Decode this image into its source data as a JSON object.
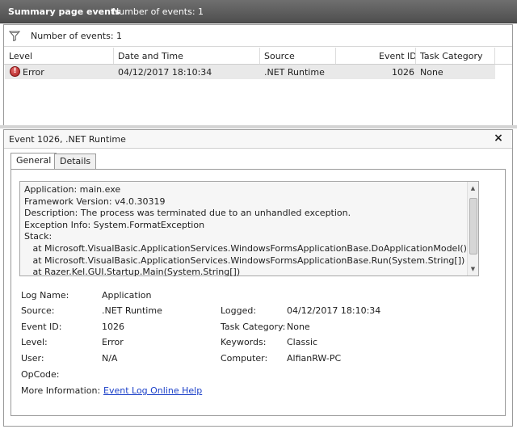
{
  "titlebar": {
    "title": "Summary page events",
    "count": "Number of events: 1"
  },
  "filter": {
    "icon": "filter-icon",
    "text": "Number of events: 1"
  },
  "columns": {
    "level": "Level",
    "datetime": "Date and Time",
    "source": "Source",
    "event_id": "Event ID",
    "task_category": "Task Category"
  },
  "rows": [
    {
      "level_icon": "error-icon",
      "level": "Error",
      "datetime": "04/12/2017 18:10:34",
      "source": ".NET Runtime",
      "event_id": "1026",
      "task_category": "None"
    }
  ],
  "detail": {
    "header": "Event 1026, .NET Runtime",
    "close_icon": "close-icon",
    "tabs": [
      "General",
      "Details"
    ],
    "active_tab": "General",
    "description_lines": [
      "Application: main.exe",
      "Framework Version: v4.0.30319",
      "Description: The process was terminated due to an unhandled exception.",
      "Exception Info: System.FormatException",
      "Stack:",
      "   at Microsoft.VisualBasic.ApplicationServices.WindowsFormsApplicationBase.DoApplicationModel()",
      "   at Microsoft.VisualBasic.ApplicationServices.WindowsFormsApplicationBase.Run(System.String[])",
      "   at Razer.Kel.GUI.Startup.Main(System.String[])"
    ],
    "fields": {
      "log_name_label": "Log Name:",
      "log_name": "Application",
      "source_label": "Source:",
      "source": ".NET Runtime",
      "logged_label": "Logged:",
      "logged": "04/12/2017 18:10:34",
      "event_id_label": "Event ID:",
      "event_id": "1026",
      "task_category_label": "Task Category:",
      "task_category": "None",
      "level_label": "Level:",
      "level": "Error",
      "keywords_label": "Keywords:",
      "keywords": "Classic",
      "user_label": "User:",
      "user": "N/A",
      "computer_label": "Computer:",
      "computer": "AlfianRW-PC",
      "opcode_label": "OpCode:",
      "opcode": "",
      "more_info_label": "More Information:",
      "more_info_link": "Event Log Online Help"
    }
  },
  "colors": {
    "titlebar": "#5a5a5a",
    "selected_row": "#e9e9e9",
    "link": "#1a3fc8",
    "error": "#b02020"
  }
}
